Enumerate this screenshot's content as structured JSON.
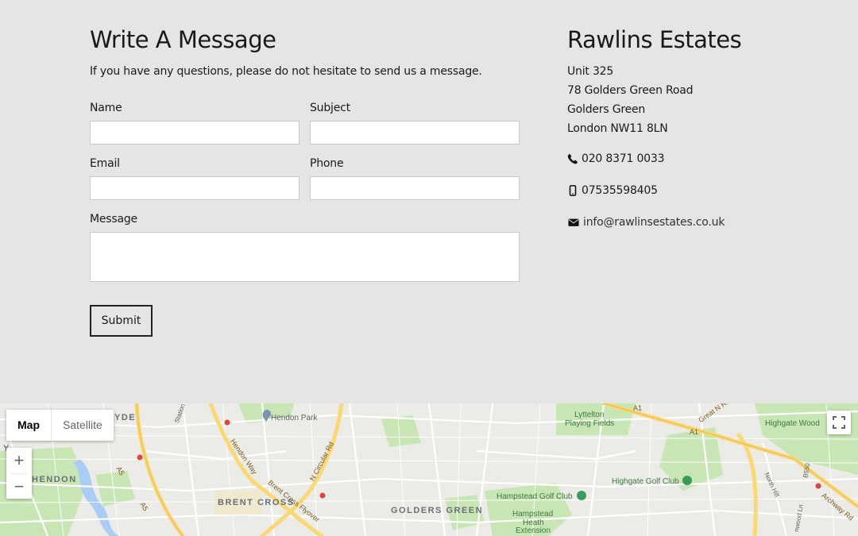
{
  "form": {
    "title": "Write A Message",
    "intro": "If you have any questions, please do not hesitate to send us a message.",
    "name_label": "Name",
    "subject_label": "Subject",
    "email_label": "Email",
    "phone_label": "Phone",
    "message_label": "Message",
    "name_value": "",
    "subject_value": "",
    "email_value": "",
    "phone_value": "",
    "message_value": "",
    "submit_label": "Submit"
  },
  "company": {
    "name": "Rawlins Estates",
    "address": [
      "Unit 325",
      "78 Golders Green Road",
      "Golders Green",
      "London NW11 8LN"
    ],
    "phone": "020 8371 0033",
    "mobile": "07535598405",
    "email": "info@rawlinsestates.co.uk",
    "icons": {
      "phone": "phone-icon",
      "mobile": "mobile-icon",
      "email": "envelope-icon"
    }
  },
  "map": {
    "type_map": "Map",
    "type_satellite": "Satellite",
    "zoom_in": "+",
    "zoom_out": "−",
    "labels": {
      "hendon_park": "Hendon Park",
      "lyttelton": "Lyttelton",
      "playing_fields": "Playing Fields",
      "highgate_wood": "Highgate Wood",
      "hendon": "HENDON",
      "brent_cross": "BRENT CROSS",
      "golders_green": "GOLDERS GREEN",
      "hampstead_golf": "Hampstead Golf Club",
      "highgate_golf": "Highgate Golf Club",
      "hampstead_heath_1": "Hampstead",
      "hampstead_heath_2": "Heath",
      "hampstead_heath_3": "Extension",
      "hendon_way": "Hendon Way",
      "n_circular": "N Circular Rd",
      "brent_flyover": "Brent Cross Flyover",
      "a1_left": "A1",
      "a1_right": "A1",
      "a5": "A5",
      "a5b": "A5",
      "great_n_rd": "Great N Rd",
      "archway_rd": "Archway Rd",
      "north_hill": "North Hill",
      "b550": "B550",
      "station": "Station",
      "yde": "YDE",
      "y": "Y",
      "denewood": "nwood Ln"
    },
    "colors": {
      "green": "#c8e6b4",
      "water": "#a9cdf5",
      "road_major": "#fbd871",
      "road": "#ffffff"
    }
  }
}
